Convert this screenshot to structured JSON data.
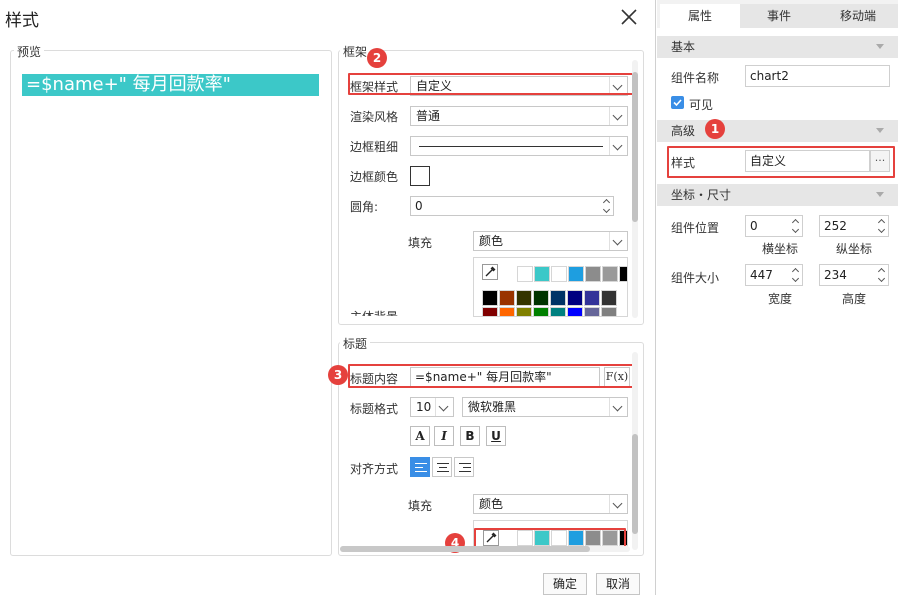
{
  "dialog": {
    "title": "样式",
    "preview": {
      "label": "预览",
      "banner_text": "=$name+\" 每月回款率\""
    },
    "frame": {
      "label": "框架",
      "frame_style_label": "框架样式",
      "frame_style_value": "自定义",
      "render_style_label": "渲染风格",
      "render_style_value": "普通",
      "border_width_label": "边框粗细",
      "border_color_label": "边框颜色",
      "radius_label": "圆角:",
      "radius_value": "0",
      "fill_label": "填充",
      "fill_value": "颜色",
      "theme_label": "主体背景"
    },
    "title_section": {
      "label": "标题",
      "content_label": "标题内容",
      "content_value": "=$name+\" 每月回款率\"",
      "fx_label": "F(x)",
      "format_label": "标题格式",
      "font_size": "10",
      "font_name": "微软雅黑",
      "bold_a": "A",
      "italic": "I",
      "bold": "B",
      "underline": "U",
      "align_label": "对齐方式",
      "fill_label": "填充",
      "fill_value": "颜色"
    },
    "confirm_button": "确定",
    "cancel_button": "取消"
  },
  "badges": [
    "1",
    "2",
    "3",
    "4"
  ],
  "palette": {
    "row1": [
      "#ffffff",
      "#3cc8c8",
      "#ffffff",
      "#1e9ee0",
      "#8c8c8c",
      "#9a9a9a",
      "#000000"
    ],
    "row2": [
      "#000000",
      "#993300",
      "#333300",
      "#003300",
      "#003366",
      "#000080",
      "#333399",
      "#333333"
    ],
    "row3": [
      "#800000",
      "#ff6600",
      "#808000",
      "#008000",
      "#008080",
      "#0000ff",
      "#666699",
      "#808080"
    ],
    "title_row": [
      "#ffffff",
      "#3cc8c8",
      "#ffffff",
      "#1e9ee0",
      "#8c8c8c",
      "#9a9a9a",
      "#000000"
    ]
  },
  "right_panel": {
    "tabs": [
      "属性",
      "事件",
      "移动端"
    ],
    "basic_section": "基本",
    "component_name_label": "组件名称",
    "component_name_value": "chart2",
    "visible_label": "可见",
    "advanced_section": "高级",
    "style_label": "样式",
    "style_value": "自定义",
    "style_more": "···",
    "coord_section": "坐标・尺寸",
    "position_label": "组件位置",
    "pos_x": "0",
    "pos_y": "252",
    "x_label": "横坐标",
    "y_label": "纵坐标",
    "size_label": "组件大小",
    "width_value": "447",
    "height_value": "234",
    "width_label": "宽度",
    "height_label": "高度"
  },
  "colors": {
    "accent_teal": "#3cc8c8",
    "badge_red": "#e5413d",
    "active_blue": "#3a8ee6"
  }
}
